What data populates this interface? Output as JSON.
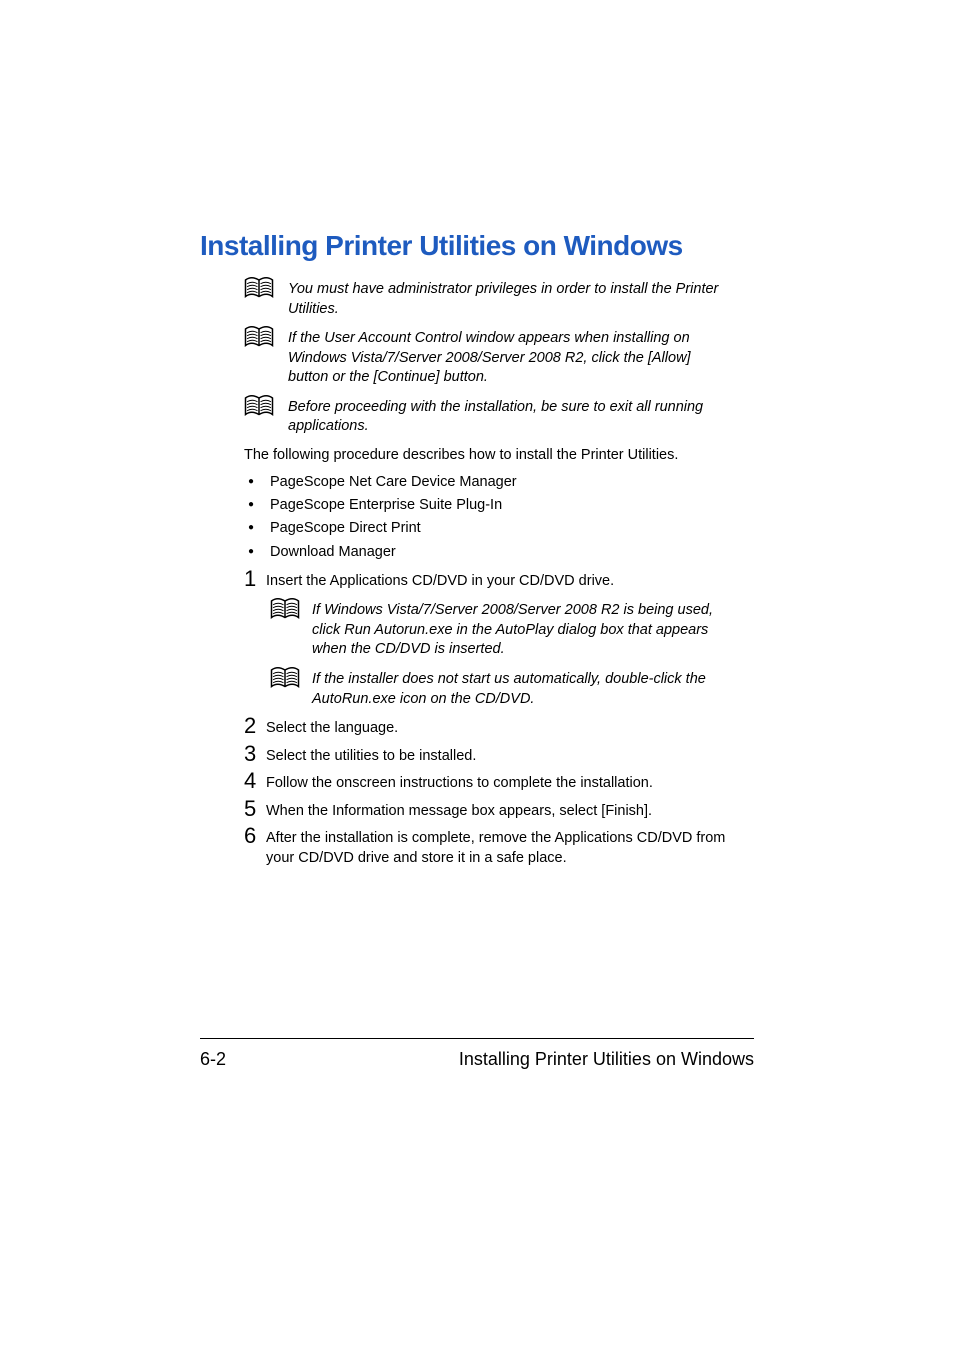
{
  "title": "Installing Printer Utilities on Windows",
  "notes": [
    "You must have administrator privileges in order to install the Printer Utilities.",
    "If the User Account Control window appears when installing on Windows Vista/7/Server 2008/Server 2008 R2, click the [Allow] button or the [Continue] button.",
    "Before proceeding with the installation, be sure to exit all running applications."
  ],
  "intro": "The following procedure describes how to install the Printer Utilities.",
  "bullets": [
    "PageScope Net Care Device Manager",
    "PageScope Enterprise Suite Plug-In",
    "PageScope Direct Print",
    "Download Manager"
  ],
  "steps": {
    "s1": {
      "num": "1",
      "text": "Insert the Applications CD/DVD in your CD/DVD drive."
    },
    "s1_note1": "If Windows Vista/7/Server 2008/Server 2008 R2 is being used, click Run Autorun.exe in the AutoPlay dialog box that appears when the CD/DVD is inserted.",
    "s1_note2": "If the installer does not start us automatically, double-click the AutoRun.exe icon on the CD/DVD.",
    "s2": {
      "num": "2",
      "text": "Select the language."
    },
    "s3": {
      "num": "3",
      "text": "Select the utilities to be installed."
    },
    "s4": {
      "num": "4",
      "text": "Follow the onscreen instructions to complete the installation."
    },
    "s5": {
      "num": "5",
      "text": "When the Information message box appears, select [Finish]."
    },
    "s6": {
      "num": "6",
      "text": "After the installation is complete, remove the Applications CD/DVD from your CD/DVD drive and store it in a safe place."
    }
  },
  "footer": {
    "page": "6-2",
    "title": "Installing Printer Utilities on Windows"
  }
}
